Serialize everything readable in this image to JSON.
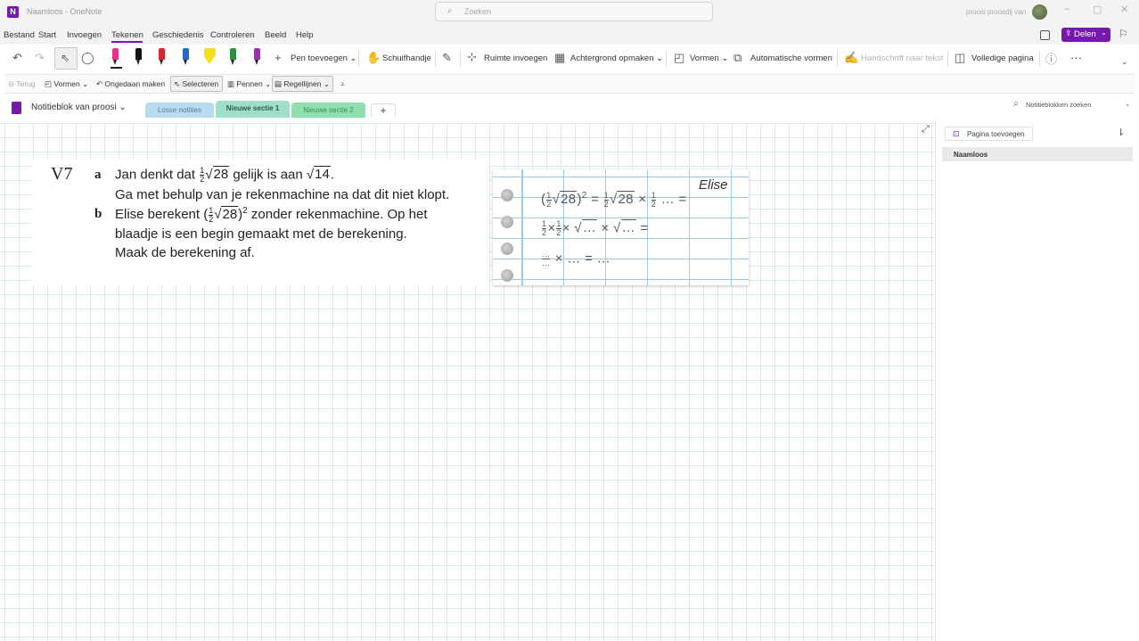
{
  "window": {
    "title": "Naamloos - OneNote",
    "search_placeholder": "Zoeken",
    "user": "proosi proosdij van",
    "minimize": "–",
    "maximize": "▢",
    "close": "✕"
  },
  "menu": {
    "items": [
      "Bestand",
      "Start",
      "Invoegen",
      "Tekenen",
      "Geschiedenis",
      "Controleren",
      "Beeld",
      "Help"
    ],
    "active": "Tekenen",
    "share_label": "Delen"
  },
  "ribbon": {
    "add_pen": "Pen toevoegen",
    "hand": "Schuifhandje",
    "insert_space": "Ruimte invoegen",
    "background": "Achtergrond opmaken",
    "shapes": "Vormen",
    "auto_shapes": "Automatische vormen",
    "ink_to_text": "Handschrift naar tekst",
    "full_page": "Volledige pagina",
    "more": "···",
    "pen_colors": [
      "#e8318a",
      "#111111",
      "#d6262f",
      "#1b6fd1",
      "#f2e01c",
      "#2f8f3c",
      "#9b2fae"
    ],
    "highlighter_color": "#f2e01c"
  },
  "quickbar": {
    "back": "Terug",
    "shapes": "Vormen",
    "undo": "Ongedaan maken",
    "select": "Selecteren",
    "pens": "Pennen",
    "rule_lines": "Regellijnen"
  },
  "notebook": {
    "name": "Notitieblok van proosi",
    "sections": [
      {
        "label": "Losse notities",
        "color": "#b9dbf2"
      },
      {
        "label": "Nieuwe sectie 1",
        "color": "#9fdfc7"
      },
      {
        "label": "Nieuwe sectie 2",
        "color": "#8fe0ae"
      }
    ],
    "add_section": "+",
    "search_placeholder": "Notitieblokken zoeken"
  },
  "exercise": {
    "number": "V7",
    "a_letter": "a",
    "a_pre": "Jan denkt dat",
    "frac_num": "1",
    "frac_den": "2",
    "a_sqrt1": "28",
    "a_mid": "gelijk is aan",
    "a_sqrt2": "14",
    "a_end": ".",
    "a_line2": "Ga met behulp van je rekenmachine na dat dit niet klopt.",
    "b_letter": "b",
    "b_pre": "Elise berekent",
    "b_sqrt": "28",
    "b_exp": "2",
    "b_post": "zonder rekenmachine. Op het",
    "b_line2": "blaadje is een begin gemaakt met de berekening.",
    "b_line3": "Maak de berekening af."
  },
  "note": {
    "author": "Elise",
    "row1_rest": "× ",
    "row1_end": "… =",
    "row2_times": "× … =",
    "row3": "× … = …",
    "sqrt_dots": "…",
    "dots_num": "…",
    "dots_den": "…"
  },
  "pages": {
    "add_label": "Pagina toevoegen",
    "items": [
      "Naamloos"
    ]
  }
}
